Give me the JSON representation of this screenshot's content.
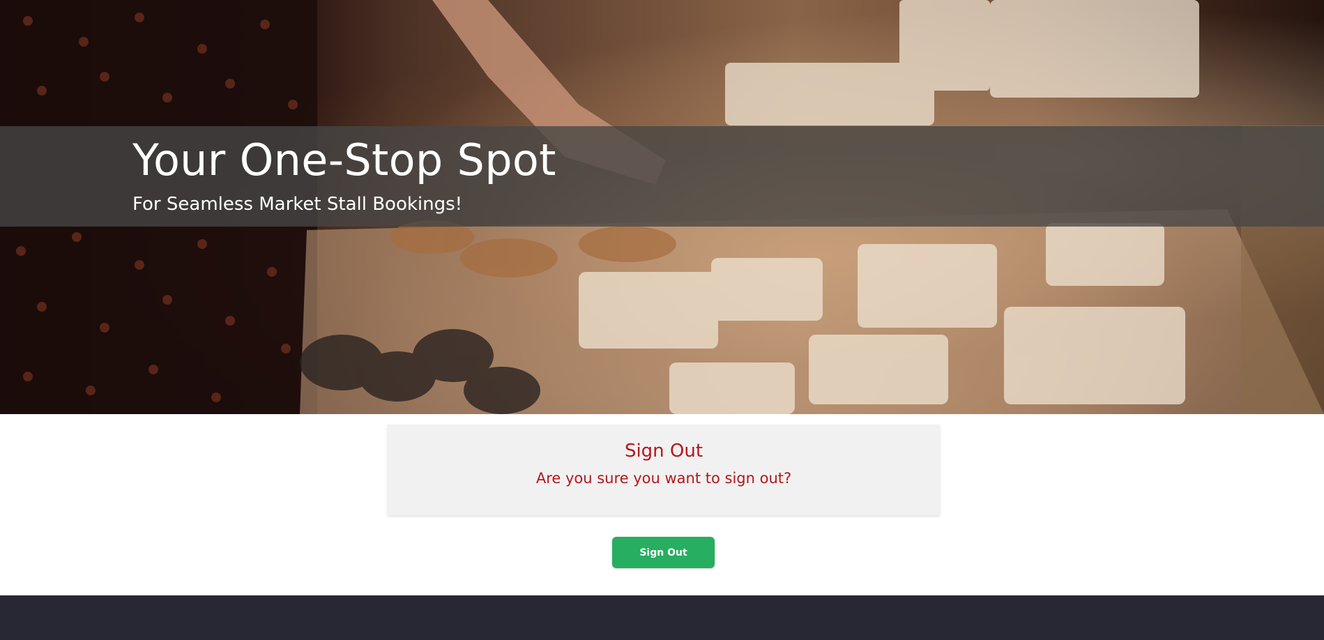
{
  "hero": {
    "title": "Your One-Stop Spot",
    "subtitle": "For Seamless Market Stall Bookings!",
    "background_image": "market-stall-crafts-photo"
  },
  "signout_card": {
    "title": "Sign Out",
    "message": "Are you sure you want to sign out?"
  },
  "actions": {
    "signout_label": "Sign Out"
  },
  "colors": {
    "accent_red": "#b3171d",
    "button_green": "#27ae60",
    "footer_bg": "#282835",
    "card_bg": "#f1f1f1"
  }
}
